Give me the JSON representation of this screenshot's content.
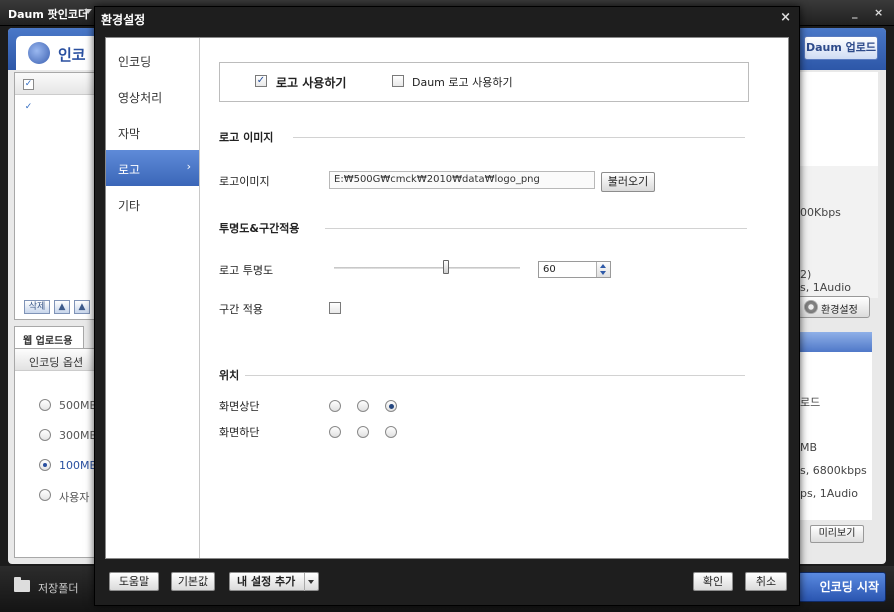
{
  "app": {
    "title": "Daum 팟인코더",
    "header_tab": "인코",
    "upload_button": "Daum 업로드",
    "list_toolbar": {
      "delete_label": "삭제"
    },
    "tab_label": "웹 업로드용",
    "panel_head": "인코딩 옵션",
    "options": [
      "500MB",
      "300MB",
      "100MB",
      "사용자"
    ],
    "selected_option_index": 2,
    "right_texts": [
      "00Kbps",
      "2)",
      "s, 1Audio",
      "로드",
      "MB",
      "s, 6800kbps",
      "ps, 1Audio"
    ],
    "env_button": "환경설정",
    "preview_button": "미리보기",
    "save_folder": "저장폴더",
    "start_button": "인코딩 시작",
    "win_minimize": "_",
    "win_close": "×"
  },
  "dialog": {
    "title": "환경설정",
    "close": "×",
    "nav": [
      {
        "label": "인코딩"
      },
      {
        "label": "영상처리"
      },
      {
        "label": "자막"
      },
      {
        "label": "로고",
        "active": true
      },
      {
        "label": "기타"
      }
    ],
    "nav_active_arrow": "›",
    "use_logo": {
      "label": "로고 사용하기",
      "checked": true
    },
    "use_daum_logo": {
      "label": "Daum 로고 사용하기",
      "checked": false
    },
    "logo_image_section": "로고 이미지",
    "logo_image_label": "로고이미지",
    "logo_path": "E:₩500G₩cmck₩2010₩data₩logo_png",
    "load_button": "불러오기",
    "transparency_section": "투명도&구간적용",
    "transparency_label": "로고 투명도",
    "transparency_value": "60",
    "slider_fraction": 0.6,
    "range_apply_label": "구간 적용",
    "range_apply_checked": false,
    "position_section": "위치",
    "position_top_label": "화면상단",
    "position_bottom_label": "화면하단",
    "position_top_selected": 2,
    "position_bottom_selected": -1,
    "footer": {
      "help": "도움말",
      "default": "기본값",
      "add_my_setting": "내 설정 추가",
      "ok": "확인",
      "cancel": "취소"
    }
  }
}
